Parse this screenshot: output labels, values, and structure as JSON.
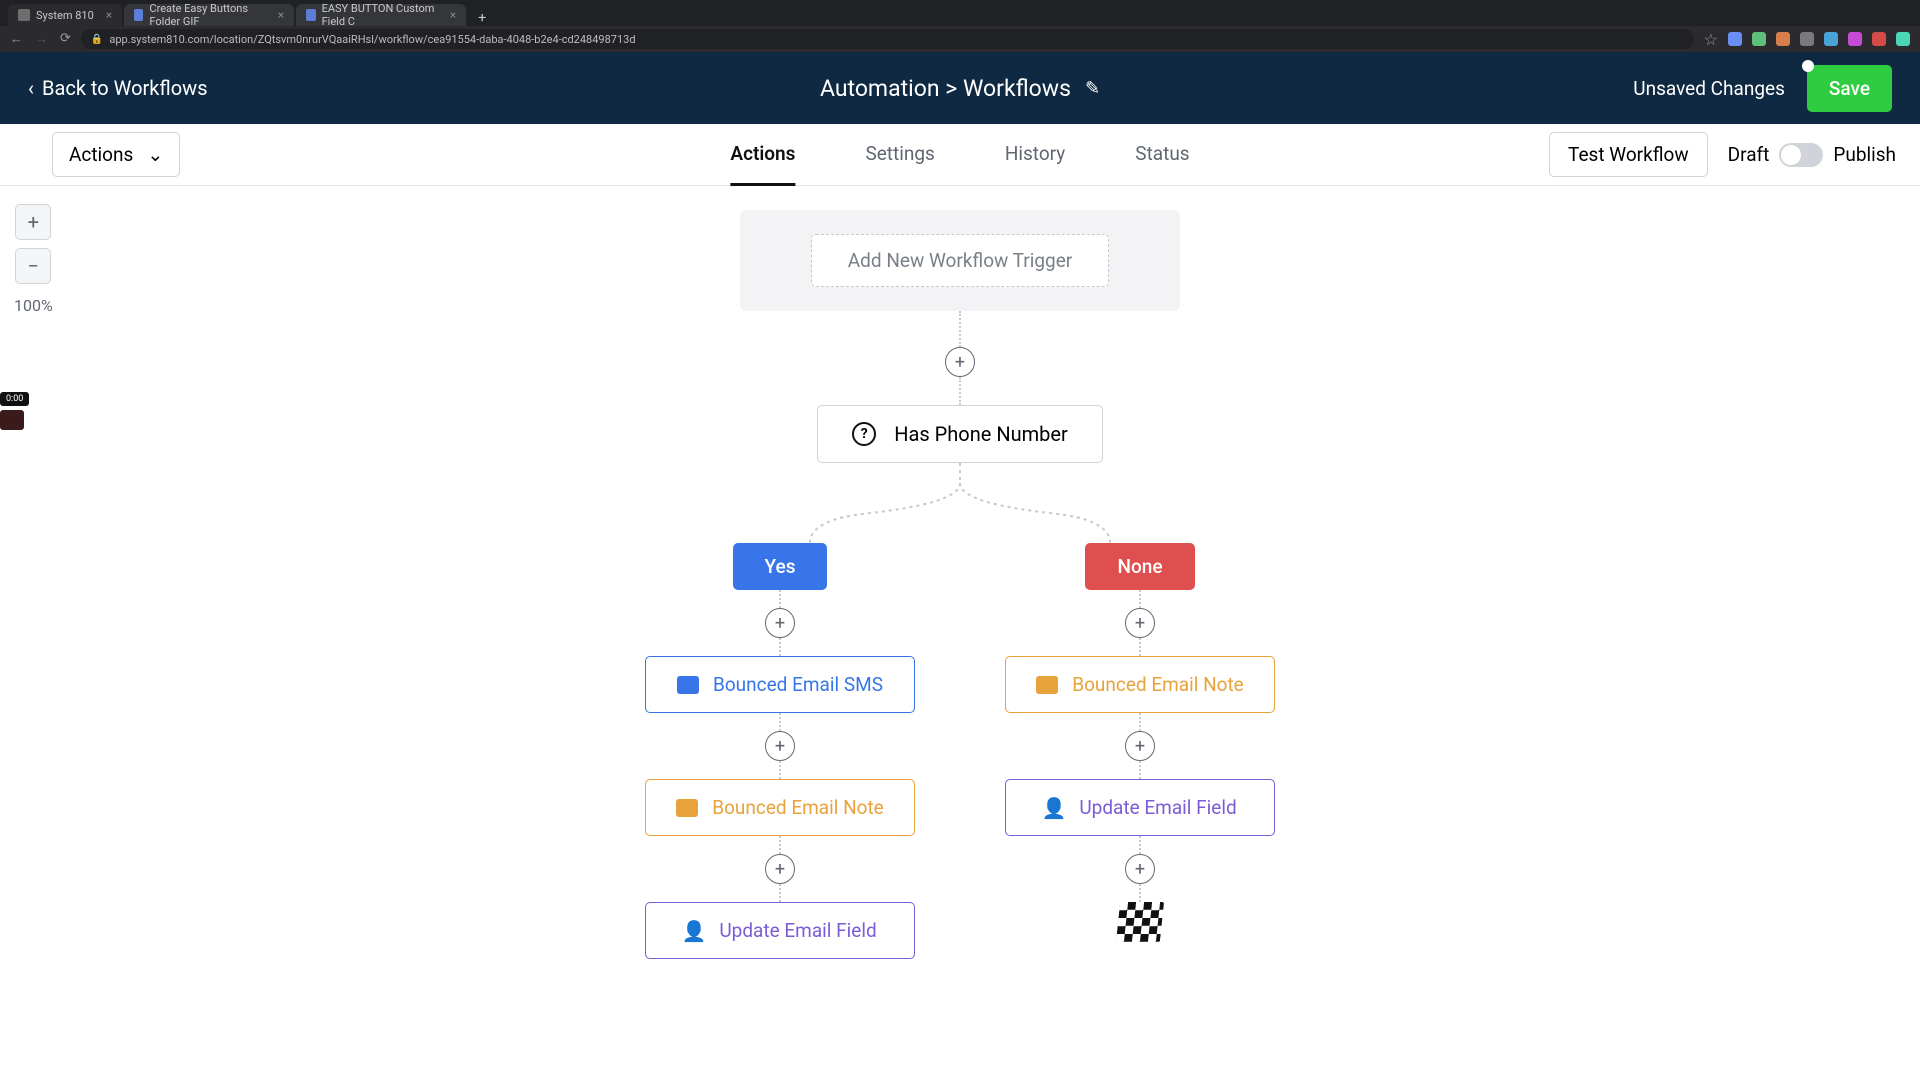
{
  "browser": {
    "tabs": [
      {
        "title": "System 810"
      },
      {
        "title": "Create Easy Buttons Folder GIF"
      },
      {
        "title": "EASY BUTTON Custom Field C"
      }
    ],
    "url": "app.system810.com/location/ZQtsvm0nrurVQaaiRHsl/workflow/cea91554-daba-4048-b2e4-cd248498713d"
  },
  "header": {
    "back_label": "Back to Workflows",
    "breadcrumb": "Automation > Workflows",
    "unsaved_label": "Unsaved Changes",
    "save_label": "Save"
  },
  "subnav": {
    "actions_dropdown": "Actions",
    "tabs": {
      "actions": "Actions",
      "settings": "Settings",
      "history": "History",
      "status": "Status"
    },
    "test_label": "Test Workflow",
    "draft_label": "Draft",
    "publish_label": "Publish"
  },
  "zoom": {
    "level": "100%"
  },
  "recorder": {
    "time": "0:00"
  },
  "flow": {
    "trigger_placeholder": "Add New Workflow Trigger",
    "condition_label": "Has Phone Number",
    "branch_yes": "Yes",
    "branch_none": "None",
    "actions": {
      "bounced_sms": "Bounced Email SMS",
      "bounced_note": "Bounced Email Note",
      "update_email": "Update Email Field"
    }
  }
}
